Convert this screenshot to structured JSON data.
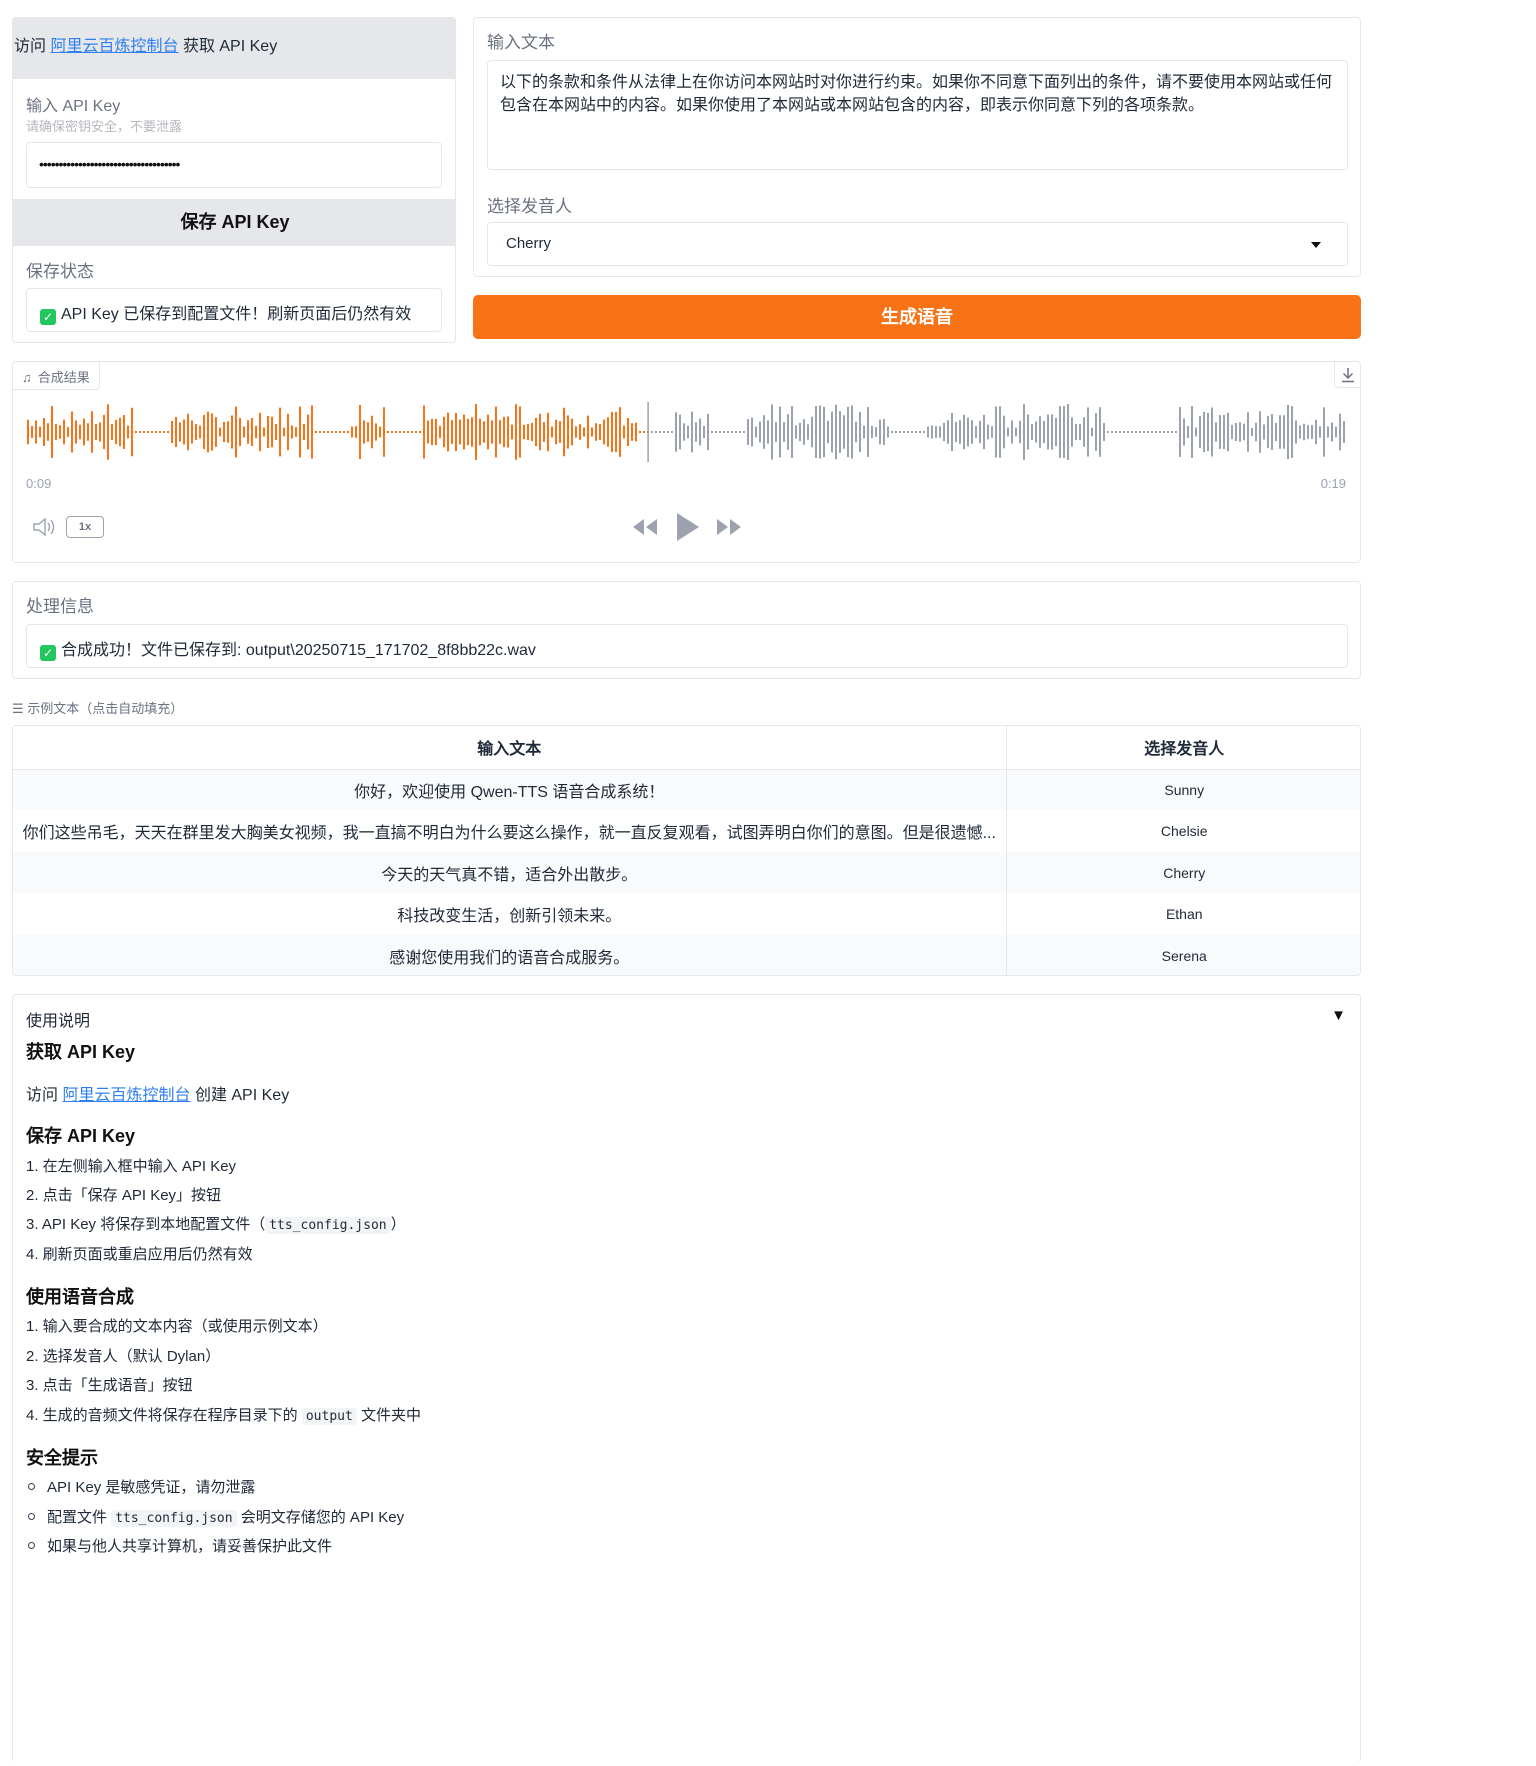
{
  "left_panel": {
    "banner_prefix": "访问",
    "banner_link": "阿里云百炼控制台",
    "banner_suffix": "获取 API Key",
    "api_key_label": "输入 API Key",
    "api_key_hint": "请确保密钥安全，不要泄露",
    "api_key_value": "••••••••••••••••••••••••••••••••••••",
    "save_button": "保存 API Key",
    "save_status_label": "保存状态",
    "save_status_text": "API Key 已保存到配置文件！刷新页面后仍然有效"
  },
  "right_panel": {
    "input_text_label": "输入文本",
    "input_text_value": "以下的条款和条件从法律上在你访问本网站时对你进行约束。如果你不同意下面列出的条件，请不要使用本网站或任何包含在本网站中的内容。如果你使用了本网站或本网站包含的内容，即表示你同意下列的各项条款。",
    "speaker_label": "选择发音人",
    "speaker_value": "Cherry",
    "generate_button": "生成语音"
  },
  "audio": {
    "tab_label": "合成结果",
    "current_time": "0:09",
    "total_time": "0:19",
    "speed": "1x",
    "played_fraction": 0.47,
    "played_color": "#f97316",
    "unplayed_color": "#9ca3af"
  },
  "process": {
    "label": "处理信息",
    "message": "合成成功！文件已保存到: output\\20250715_171702_8f8bb22c.wav"
  },
  "examples": {
    "title": "示例文本（点击自动填充）",
    "headers": [
      "输入文本",
      "选择发音人"
    ],
    "rows": [
      {
        "text": "你好，欢迎使用 Qwen-TTS 语音合成系统！",
        "speaker": "Sunny"
      },
      {
        "text": "你们这些吊毛，天天在群里发大胸美女视频，我一直搞不明白为什么要这么操作，就一直反复观看，试图弄明白你们的意图。但是很遗憾...",
        "speaker": "Chelsie"
      },
      {
        "text": "今天的天气真不错，适合外出散步。",
        "speaker": "Cherry"
      },
      {
        "text": "科技改变生活，创新引领未来。",
        "speaker": "Ethan"
      },
      {
        "text": "感谢您使用我们的语音合成服务。",
        "speaker": "Serena"
      }
    ]
  },
  "instructions": {
    "accordion_label": "使用说明",
    "h_get_key": "获取 API Key",
    "get_key_prefix": "访问",
    "get_key_link": "阿里云百炼控制台",
    "get_key_suffix": "创建 API Key",
    "h_save_key": "保存 API Key",
    "save_steps": {
      "s1": "1. 在左侧输入框中输入 API Key",
      "s2": "2. 点击「保存 API Key」按钮",
      "s3_prefix": "3. API Key 将保存到本地配置文件（",
      "s3_code": "tts_config.json",
      "s3_suffix": "）",
      "s4": "4. 刷新页面或重启应用后仍然有效"
    },
    "h_use": "使用语音合成",
    "use_steps": {
      "s1": "1. 输入要合成的文本内容（或使用示例文本）",
      "s2": "2. 选择发音人（默认 Dylan）",
      "s3": "3. 点击「生成语音」按钮",
      "s4_prefix": "4. 生成的音频文件将保存在程序目录下的",
      "s4_code": "output",
      "s4_suffix": "文件夹中"
    },
    "h_security": "安全提示",
    "security": {
      "b1": "API Key 是敏感凭证，请勿泄露",
      "b2_prefix": "配置文件",
      "b2_code": "tts_config.json",
      "b2_suffix": "会明文存储您的 API Key",
      "b3": "如果与他人共享计算机，请妥善保护此文件"
    }
  },
  "colors": {
    "accent": "#f97316",
    "link": "#2f7ff0",
    "success": "#22c55e"
  }
}
